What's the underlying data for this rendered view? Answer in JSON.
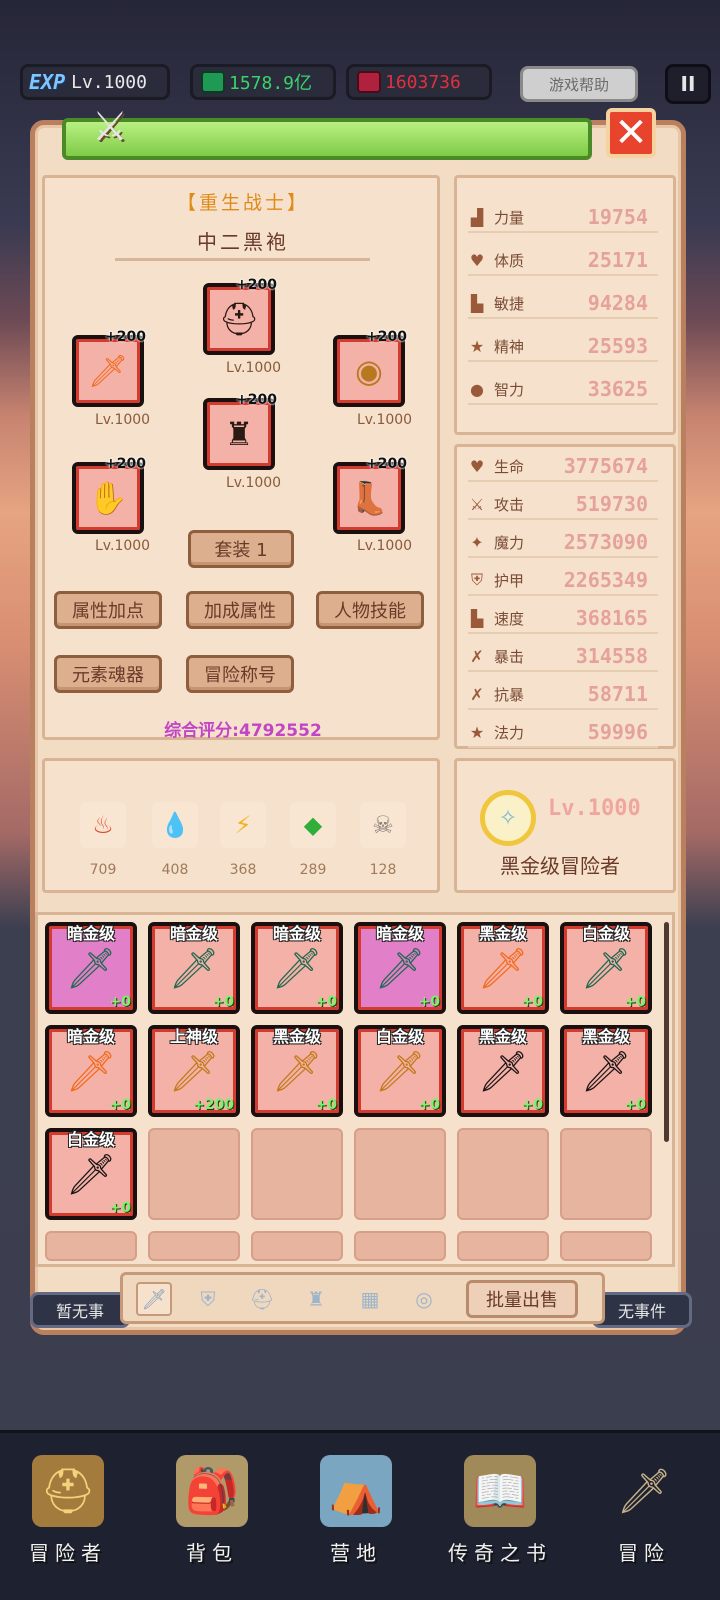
{
  "topbar": {
    "exp_label": "EXP",
    "level": "Lv.1000",
    "currency1": "1578.9亿",
    "currency2": "1603736",
    "help": "游戏帮助",
    "pause": "II"
  },
  "hero": {
    "class_name": "【重生战士】",
    "name": "中二黑袍",
    "equipment": [
      {
        "slot": "weapon",
        "plus": "+200",
        "level": "Lv.1000",
        "icon": "flame-sword"
      },
      {
        "slot": "helmet",
        "plus": "+200",
        "level": "Lv.1000",
        "icon": "black-helmet"
      },
      {
        "slot": "shield",
        "plus": "+200",
        "level": "Lv.1000",
        "icon": "round-shield"
      },
      {
        "slot": "armor",
        "plus": "+200",
        "level": "Lv.1000",
        "icon": "black-armor"
      },
      {
        "slot": "gloves",
        "plus": "+200",
        "level": "Lv.1000",
        "icon": "black-gloves"
      },
      {
        "slot": "boots",
        "plus": "+200",
        "level": "Lv.1000",
        "icon": "black-boots"
      }
    ],
    "set_button": "套装 1",
    "buttons": [
      "属性加点",
      "加成属性",
      "人物技能",
      "元素魂器",
      "冒险称号"
    ],
    "score": "综合评分:4792552"
  },
  "resources": [
    {
      "icon": "fire",
      "value": "709",
      "color": "#e8432d"
    },
    {
      "icon": "water",
      "value": "408",
      "color": "#3a8ee6"
    },
    {
      "icon": "lightning",
      "value": "368",
      "color": "#f2b21e"
    },
    {
      "icon": "earth",
      "value": "289",
      "color": "#2fae3a"
    },
    {
      "icon": "skull",
      "value": "128",
      "color": "#8a7a78"
    }
  ],
  "base_stats": [
    {
      "name": "力量",
      "value": "19754",
      "icon": "strength"
    },
    {
      "name": "体质",
      "value": "25171",
      "icon": "heart"
    },
    {
      "name": "敏捷",
      "value": "94284",
      "icon": "boot"
    },
    {
      "name": "精神",
      "value": "25593",
      "icon": "star"
    },
    {
      "name": "智力",
      "value": "33625",
      "icon": "brain"
    }
  ],
  "combat_stats": [
    {
      "name": "生命",
      "value": "3775674",
      "icon": "heart"
    },
    {
      "name": "攻击",
      "value": "519730",
      "icon": "sword"
    },
    {
      "name": "魔力",
      "value": "2573090",
      "icon": "magic"
    },
    {
      "name": "护甲",
      "value": "2265349",
      "icon": "shield"
    },
    {
      "name": "速度",
      "value": "368165",
      "icon": "boot"
    },
    {
      "name": "暴击",
      "value": "314558",
      "icon": "crit"
    },
    {
      "name": "抗暴",
      "value": "58711",
      "icon": "crit"
    },
    {
      "name": "法力",
      "value": "59996",
      "icon": "star"
    }
  ],
  "badge": {
    "level": "Lv.1000",
    "title": "黑金级冒险者"
  },
  "inventory": [
    {
      "grade": "暗金级",
      "enh": "+0",
      "bg": "purple",
      "icon": "green-sword"
    },
    {
      "grade": "暗金级",
      "enh": "+0",
      "bg": "red",
      "icon": "green-sword"
    },
    {
      "grade": "暗金级",
      "enh": "+0",
      "bg": "red",
      "icon": "green-sword"
    },
    {
      "grade": "暗金级",
      "enh": "+0",
      "bg": "purple",
      "icon": "green-sword"
    },
    {
      "grade": "黑金级",
      "enh": "+0",
      "bg": "red",
      "icon": "flame-sword"
    },
    {
      "grade": "白金级",
      "enh": "+0",
      "bg": "red",
      "icon": "green-sword"
    },
    {
      "grade": "暗金级",
      "enh": "+0",
      "bg": "red",
      "icon": "flame-sword"
    },
    {
      "grade": "上神级",
      "enh": "+200",
      "bg": "red",
      "icon": "gold-sword"
    },
    {
      "grade": "黑金级",
      "enh": "+0",
      "bg": "red",
      "icon": "gold-sword"
    },
    {
      "grade": "白金级",
      "enh": "+0",
      "bg": "red",
      "icon": "gold-sword"
    },
    {
      "grade": "黑金级",
      "enh": "+0",
      "bg": "red",
      "icon": "dark-sword"
    },
    {
      "grade": "黑金级",
      "enh": "+0",
      "bg": "red",
      "icon": "dark-sword"
    },
    {
      "grade": "白金级",
      "enh": "+0",
      "bg": "red",
      "icon": "dark-sword"
    }
  ],
  "tabs": [
    {
      "icon": "sword-tab",
      "active": true
    },
    {
      "icon": "armor-tab",
      "active": false
    },
    {
      "icon": "helmet-tab",
      "active": false
    },
    {
      "icon": "chest-tab",
      "active": false
    },
    {
      "icon": "pants-tab",
      "active": false
    },
    {
      "icon": "ring-tab",
      "active": false
    }
  ],
  "sell_button": "批量出售",
  "events": {
    "left": "暂无事",
    "right": "无事件"
  },
  "nav": [
    {
      "label": "冒险者",
      "icon": "helmet"
    },
    {
      "label": "背包",
      "icon": "bag"
    },
    {
      "label": "营地",
      "icon": "camp"
    },
    {
      "label": "传奇之书",
      "icon": "book"
    },
    {
      "label": "冒险",
      "icon": "sword"
    }
  ]
}
